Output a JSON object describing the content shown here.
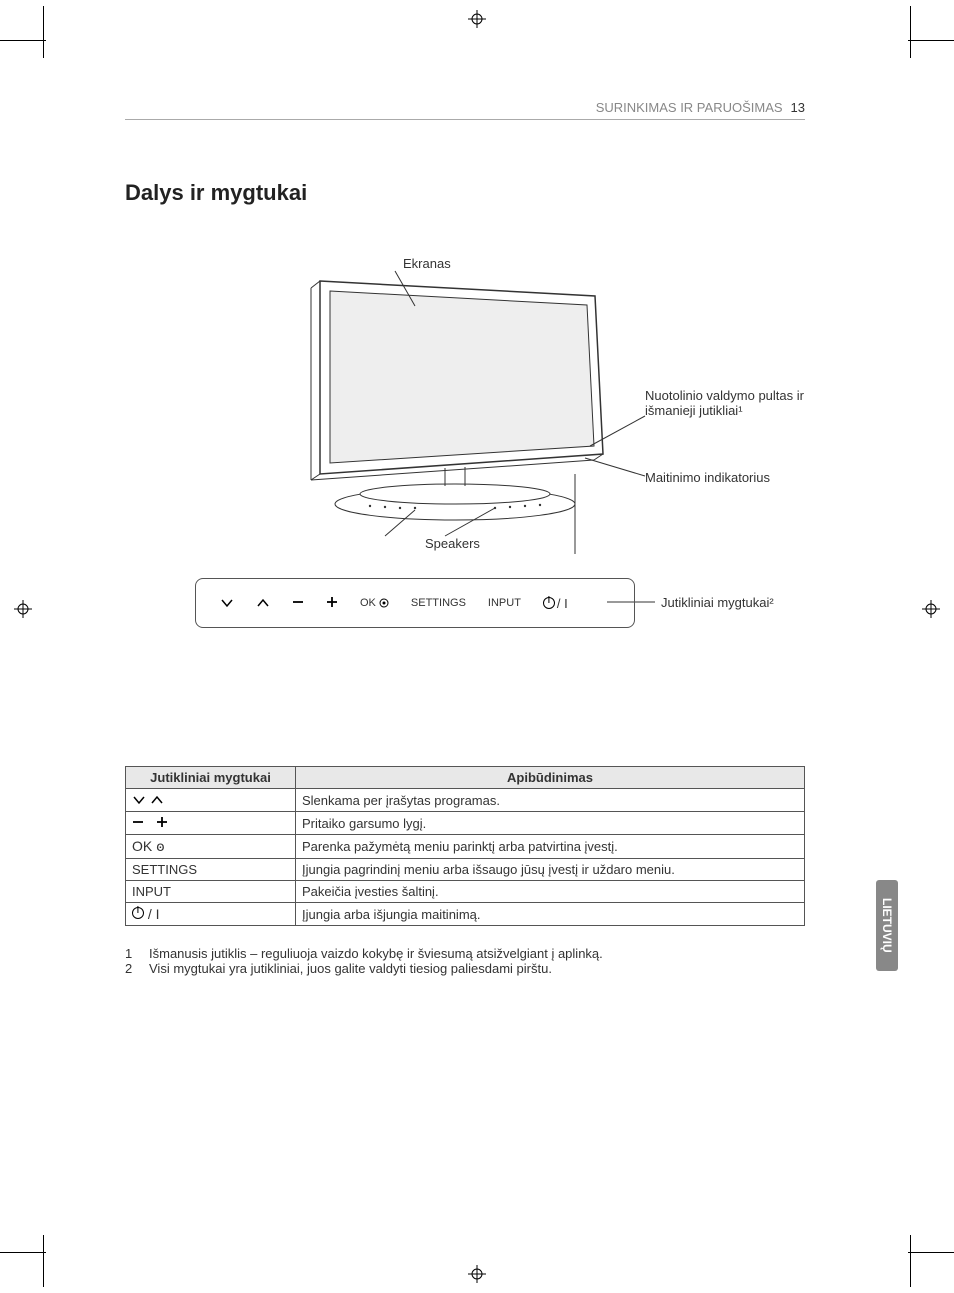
{
  "header": {
    "section": "SURINKIMAS IR PARUOŠIMAS",
    "page": "13"
  },
  "title": "Dalys ir mygtukai",
  "diagram": {
    "screen": "Ekranas",
    "remote_sensor": "Nuotolinio valdymo pultas ir išmanieji jutikliai¹",
    "power_indicator": "Maitinimo indikatorius",
    "speakers": "Speakers",
    "touch_buttons": "Jutikliniai mygtukai²",
    "bar": {
      "ok": "OK",
      "settings": "SETTINGS",
      "input": "INPUT"
    }
  },
  "table": {
    "head": {
      "col1": "Jutikliniai mygtukai",
      "col2": "Apibūdinimas"
    },
    "rows": [
      {
        "key_icons": "chevrons",
        "key_text": "",
        "desc": "Slenkama per įrašytas programas."
      },
      {
        "key_icons": "plusminus",
        "key_text": "",
        "desc": "Pritaiko garsumo lygį."
      },
      {
        "key_icons": "ok",
        "key_text": "OK ꙩ",
        "desc": "Parenka pažymėtą meniu parinktį arba patvirtina įvestį."
      },
      {
        "key_icons": "",
        "key_text": "SETTINGS",
        "desc": "Įjungia pagrindinį meniu arba išsaugo jūsų įvestį ir uždaro meniu."
      },
      {
        "key_icons": "",
        "key_text": "INPUT",
        "desc": "Pakeičia įvesties šaltinį."
      },
      {
        "key_icons": "power",
        "key_text": "",
        "desc": "Įjungia arba išjungia maitinimą."
      }
    ]
  },
  "footnotes": {
    "n1": "Išmanusis jutiklis – reguliuoja vaizdo kokybę ir šviesumą atsižvelgiant į aplinką.",
    "n2": "Visi mygtukai yra jutikliniai, juos galite valdyti tiesiog paliesdami pirštu."
  },
  "side_tab": "LIETUVIŲ"
}
